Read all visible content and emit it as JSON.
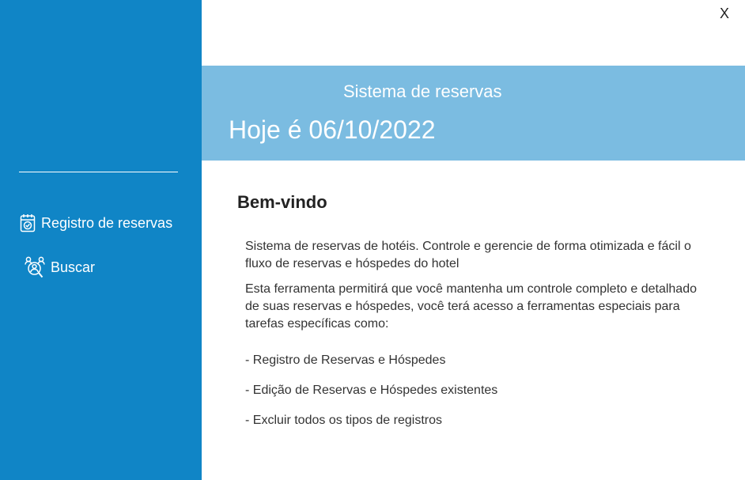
{
  "window": {
    "close_label": "X"
  },
  "sidebar": {
    "background": "#1085c6",
    "items": [
      {
        "label": "Registro de reservas",
        "icon": "calendar-check-icon"
      },
      {
        "label": "Buscar",
        "icon": "users-search-icon"
      }
    ]
  },
  "header": {
    "background": "#7bbce1",
    "system_title": "Sistema de reservas",
    "date_text": "Hoje é 06/10/2022"
  },
  "main": {
    "welcome_title": "Bem-vindo",
    "paragraphs": [
      "Sistema de reservas de hotéis. Controle e gerencie de forma otimizada e fácil o fluxo de reservas e hóspedes do hotel",
      "Esta ferramenta permitirá que você mantenha um controle completo e detalhado de suas reservas e hóspedes, você terá acesso a ferramentas especiais para tarefas específicas como:"
    ],
    "features": [
      "- Registro de Reservas e Hóspedes",
      "- Edição de Reservas e Hóspedes existentes",
      "- Excluir todos os tipos de registros"
    ]
  }
}
